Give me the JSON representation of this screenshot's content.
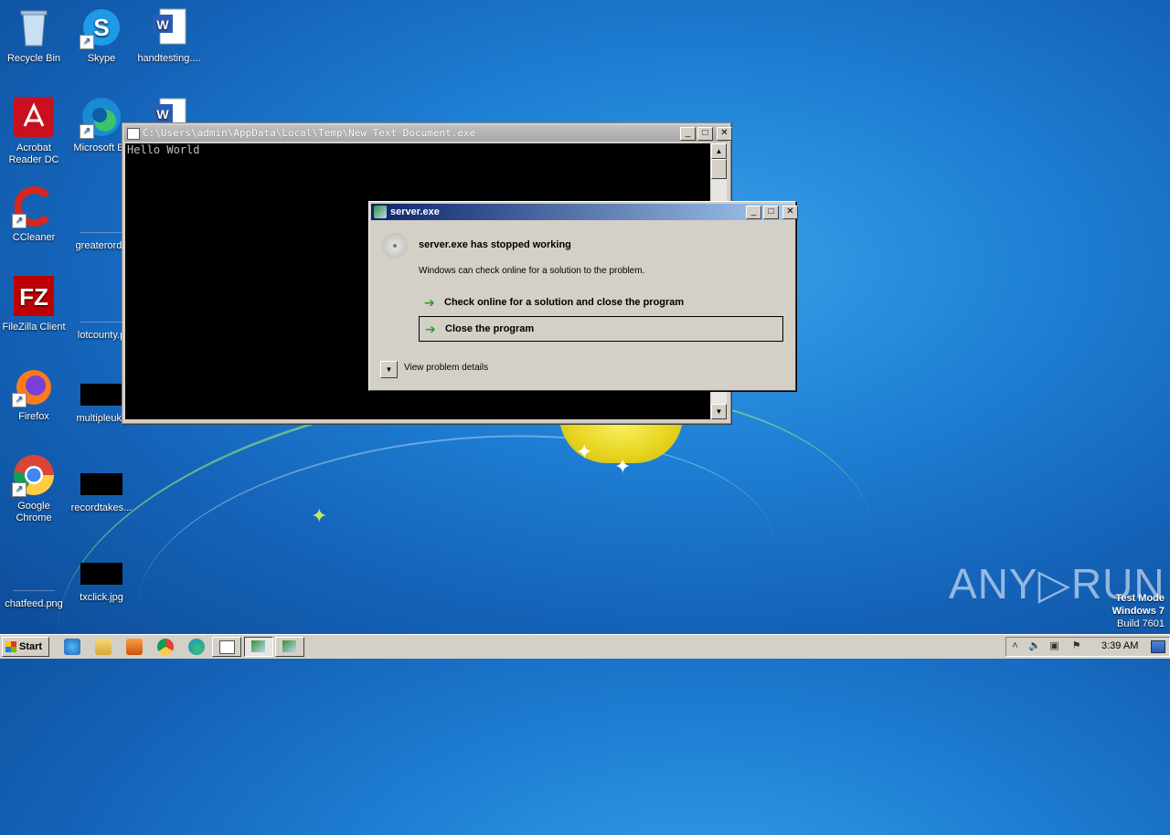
{
  "desktop": {
    "icons": [
      {
        "label": "Recycle Bin"
      },
      {
        "label": "Skype"
      },
      {
        "label": "handtesting...."
      },
      {
        "label": "Acrobat Reader DC"
      },
      {
        "label": "Microsoft Ed"
      },
      {
        "label": "CCleaner"
      },
      {
        "label": "greaterorde"
      },
      {
        "label": "FileZilla Client"
      },
      {
        "label": "lotcounty.p"
      },
      {
        "label": "Firefox"
      },
      {
        "label": "multipleuk.j"
      },
      {
        "label": "Google Chrome"
      },
      {
        "label": "recordtakes..."
      },
      {
        "label": "chatfeed.png"
      },
      {
        "label": "txclick.jpg"
      }
    ]
  },
  "console": {
    "title": "C:\\Users\\admin\\AppData\\Local\\Temp\\New Text Document.exe",
    "output": "Hello World",
    "buttons": {
      "minimize": "_",
      "maximize": "□",
      "close": "✕"
    }
  },
  "dialog": {
    "title": "server.exe",
    "headline": "server.exe has stopped working",
    "message": "Windows can check online for a solution to the problem.",
    "option1": "Check online for a solution and close the program",
    "option2": "Close the program",
    "details": "View problem details",
    "arrow": "➔"
  },
  "watermark": {
    "brand": "ANY▷RUN",
    "mode": "Test Mode",
    "os": "Windows 7",
    "build": "Build 7601"
  },
  "taskbar": {
    "start": "Start",
    "clock": "3:39 AM",
    "tray_expand": "˄"
  },
  "colors": {
    "title_active": "#0a246a",
    "title_inactive": "#a8a8a8",
    "accent_green": "#2aa02a"
  }
}
